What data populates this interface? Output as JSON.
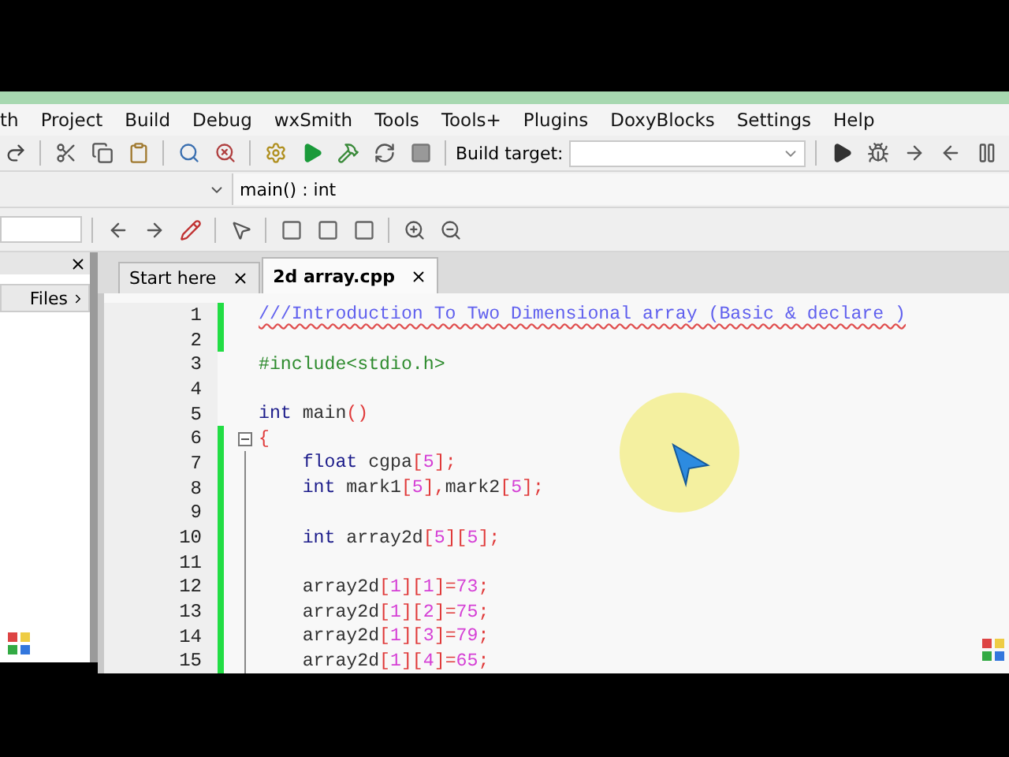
{
  "menu": [
    "th",
    "Project",
    "Build",
    "Debug",
    "wxSmith",
    "Tools",
    "Tools+",
    "Plugins",
    "DoxyBlocks",
    "Settings",
    "Help"
  ],
  "build_target": {
    "label": "Build target:"
  },
  "function_bar": {
    "value": "main() : int"
  },
  "side_panel": {
    "tab": "Files"
  },
  "tabs": [
    {
      "label": "Start here",
      "selected": false
    },
    {
      "label": "2d array.cpp",
      "selected": true
    }
  ],
  "lines": [
    {
      "number": "1",
      "changed": true,
      "fold_start": false,
      "in_fold": false,
      "tokens": [
        {
          "kind": "comment",
          "text": "///Introduction To Two Dimensional array (Basic & declare )"
        }
      ]
    },
    {
      "number": "2",
      "changed": true,
      "fold_start": false,
      "in_fold": false
    },
    {
      "number": "3",
      "changed": false,
      "fold_start": false,
      "in_fold": false,
      "tokens": [
        {
          "kind": "preproc",
          "text": "#include<stdio.h>"
        }
      ]
    },
    {
      "number": "4",
      "changed": false,
      "fold_start": false,
      "in_fold": false
    },
    {
      "number": "5",
      "changed": false,
      "fold_start": false,
      "in_fold": false,
      "tokens": [
        {
          "kind": "keyword",
          "text": "int"
        },
        {
          "kind": "plain",
          "text": " main"
        },
        {
          "kind": "operator",
          "text": "()"
        }
      ]
    },
    {
      "number": "6",
      "changed": true,
      "fold_start": true,
      "in_fold": false,
      "tokens": [
        {
          "kind": "operator",
          "text": "{"
        }
      ]
    },
    {
      "number": "7",
      "changed": true,
      "fold_start": false,
      "in_fold": true,
      "tokens": [
        {
          "kind": "keyword",
          "text": "    float"
        },
        {
          "kind": "plain",
          "text": " cgpa"
        },
        {
          "kind": "operator",
          "text": "["
        },
        {
          "kind": "number",
          "text": "5"
        },
        {
          "kind": "operator",
          "text": "];"
        }
      ]
    },
    {
      "number": "8",
      "changed": true,
      "fold_start": false,
      "in_fold": true,
      "tokens": [
        {
          "kind": "keyword",
          "text": "    int"
        },
        {
          "kind": "plain",
          "text": " mark1"
        },
        {
          "kind": "operator",
          "text": "["
        },
        {
          "kind": "number",
          "text": "5"
        },
        {
          "kind": "operator",
          "text": "],"
        },
        {
          "kind": "plain",
          "text": "mark2"
        },
        {
          "kind": "operator",
          "text": "["
        },
        {
          "kind": "number",
          "text": "5"
        },
        {
          "kind": "operator",
          "text": "];"
        }
      ]
    },
    {
      "number": "9",
      "changed": true,
      "fold_start": false,
      "in_fold": true
    },
    {
      "number": "10",
      "changed": true,
      "fold_start": false,
      "in_fold": true,
      "tokens": [
        {
          "kind": "keyword",
          "text": "    int"
        },
        {
          "kind": "plain",
          "text": " array2d"
        },
        {
          "kind": "operator",
          "text": "["
        },
        {
          "kind": "number",
          "text": "5"
        },
        {
          "kind": "operator",
          "text": "]["
        },
        {
          "kind": "number",
          "text": "5"
        },
        {
          "kind": "operator",
          "text": "];"
        }
      ]
    },
    {
      "number": "11",
      "changed": true,
      "fold_start": false,
      "in_fold": true
    },
    {
      "number": "12",
      "changed": true,
      "fold_start": false,
      "in_fold": true,
      "tokens": [
        {
          "kind": "plain",
          "text": "    array2d"
        },
        {
          "kind": "operator",
          "text": "["
        },
        {
          "kind": "number",
          "text": "1"
        },
        {
          "kind": "operator",
          "text": "]["
        },
        {
          "kind": "number",
          "text": "1"
        },
        {
          "kind": "operator",
          "text": "]="
        },
        {
          "kind": "number",
          "text": "73"
        },
        {
          "kind": "operator",
          "text": ";"
        }
      ]
    },
    {
      "number": "13",
      "changed": true,
      "fold_start": false,
      "in_fold": true,
      "tokens": [
        {
          "kind": "plain",
          "text": "    array2d"
        },
        {
          "kind": "operator",
          "text": "["
        },
        {
          "kind": "number",
          "text": "1"
        },
        {
          "kind": "operator",
          "text": "]["
        },
        {
          "kind": "number",
          "text": "2"
        },
        {
          "kind": "operator",
          "text": "]="
        },
        {
          "kind": "number",
          "text": "75"
        },
        {
          "kind": "operator",
          "text": ";"
        }
      ]
    },
    {
      "number": "14",
      "changed": true,
      "fold_start": false,
      "in_fold": true,
      "tokens": [
        {
          "kind": "plain",
          "text": "    array2d"
        },
        {
          "kind": "operator",
          "text": "["
        },
        {
          "kind": "number",
          "text": "1"
        },
        {
          "kind": "operator",
          "text": "]["
        },
        {
          "kind": "number",
          "text": "3"
        },
        {
          "kind": "operator",
          "text": "]="
        },
        {
          "kind": "number",
          "text": "79"
        },
        {
          "kind": "operator",
          "text": ";"
        }
      ]
    },
    {
      "number": "15",
      "changed": true,
      "fold_start": false,
      "in_fold": true,
      "tokens": [
        {
          "kind": "plain",
          "text": "    array2d"
        },
        {
          "kind": "operator",
          "text": "["
        },
        {
          "kind": "number",
          "text": "1"
        },
        {
          "kind": "operator",
          "text": "]["
        },
        {
          "kind": "number",
          "text": "4"
        },
        {
          "kind": "operator",
          "text": "]="
        },
        {
          "kind": "number",
          "text": "65"
        },
        {
          "kind": "operator",
          "text": ";"
        }
      ]
    }
  ]
}
